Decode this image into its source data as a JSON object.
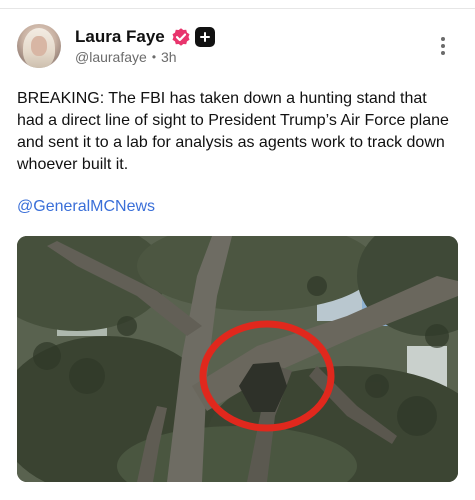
{
  "post": {
    "author": {
      "display_name": "Laura Faye",
      "handle": "@laurafaye",
      "age": "3h",
      "verified_badge_color": "#e8356d",
      "avatar_icon": "avatar-photo"
    },
    "text": "BREAKING: The FBI has taken down a hunting stand that had a direct line of sight to President Trump’s Air Force plane and sent it to a lab for analysis as agents work to track down whoever built it.",
    "mention": "@GeneralMCNews",
    "media": {
      "kind": "photo",
      "subject": "tree canopy with red circle annotation",
      "annotation_color": "#e0281d"
    }
  }
}
